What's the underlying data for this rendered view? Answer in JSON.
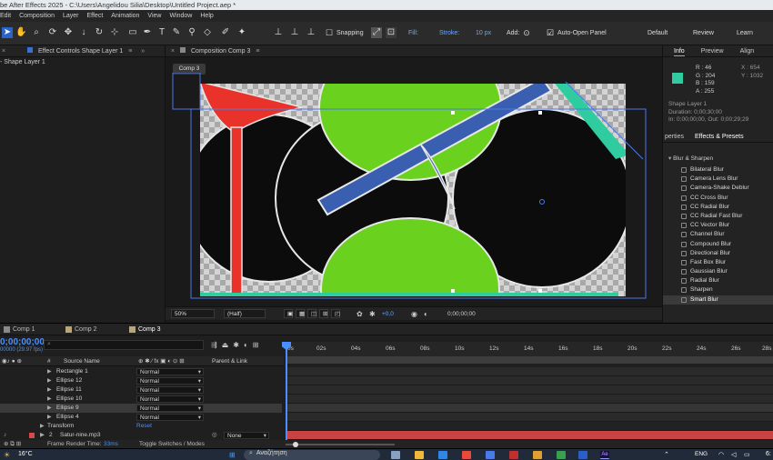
{
  "window": {
    "title": "be After Effects 2025 - C:\\Users\\Angelidou Silia\\Desktop\\Untitled Project.aep *"
  },
  "menu": [
    "Edit",
    "Composition",
    "Layer",
    "Effect",
    "Animation",
    "View",
    "Window",
    "Help"
  ],
  "toolbar": {
    "snapping": "Snapping",
    "fill": "Fill:",
    "stroke": "Stroke:",
    "stroke_px": "10 px",
    "add": "Add:",
    "auto_open": "Auto-Open Panel",
    "workspaces": [
      "Default",
      "Review",
      "Learn"
    ]
  },
  "left_panel": {
    "tab": "Effect Controls Shape Layer 1",
    "subtitle": "- Shape Layer 1"
  },
  "comp_panel": {
    "tab": "Composition Comp 3",
    "comp_button": "Comp 3"
  },
  "viewer": {
    "zoom": "50%",
    "resolution": "(Half)",
    "exposure": "+0,0",
    "timecode": "0;00;00;00"
  },
  "info_panel": {
    "tabs": [
      "Info",
      "Preview",
      "Align"
    ],
    "r": "R : 46",
    "g": "G : 204",
    "b": "B : 159",
    "a": "A : 255",
    "x": "X : 654",
    "y": "Y : 1032",
    "swatch_color": "#2ecc9f",
    "layer": "Shape Layer 1",
    "duration": "Duration: 0;00;30;00",
    "in": "In: 0;00;00;00, Out: 0;00;29;29"
  },
  "effects_panel": {
    "tabs": [
      "perties",
      "Effects & Presets"
    ],
    "category": "Blur & Sharpen",
    "items": [
      "Bilateral Blur",
      "Camera Lens Blur",
      "Camera-Shake Deblur",
      "CC Cross Blur",
      "CC Radial Blur",
      "CC Radial Fast Blur",
      "CC Vector Blur",
      "Channel Blur",
      "Compound Blur",
      "Directional Blur",
      "Fast Box Blur",
      "Gaussian Blur",
      "Radial Blur",
      "Sharpen",
      "Smart Blur"
    ],
    "selected": "Smart Blur"
  },
  "timeline": {
    "tabs": [
      {
        "label": "Comp 1",
        "color": "#8a8a8a"
      },
      {
        "label": "Comp 2",
        "color": "#b8a878"
      },
      {
        "label": "Comp 3",
        "color": "#b8a878"
      }
    ],
    "timecode": "0;00;00;00",
    "fps": "00000 (29.97 fps)",
    "col_hash": "#",
    "col_source": "Source Name",
    "col_parent": "Parent & Link",
    "layers": [
      {
        "name": "Rectangle 1",
        "mode": "Normal"
      },
      {
        "name": "Ellipse 12",
        "mode": "Normal"
      },
      {
        "name": "Ellipse 11",
        "mode": "Normal"
      },
      {
        "name": "Ellipse 10",
        "mode": "Normal"
      },
      {
        "name": "Ellipse 9",
        "mode": "Normal"
      },
      {
        "name": "Ellipse 4",
        "mode": "Normal"
      }
    ],
    "transform": "Transform",
    "reset": "Reset",
    "audio_layer": {
      "num": "2",
      "name": "Satur-nine.mp3",
      "parent": "None"
    },
    "ruler": [
      "0s",
      "02s",
      "04s",
      "06s",
      "08s",
      "10s",
      "12s",
      "14s",
      "16s",
      "18s",
      "20s",
      "22s",
      "24s",
      "26s",
      "28s"
    ],
    "frame_render_label": "Frame Render Time:",
    "frame_render_value": "33ms",
    "toggle": "Toggle Switches / Modes"
  },
  "taskbar": {
    "temp": "16°C",
    "search": "Αναζήτηση",
    "lang": "ENG",
    "clock": "6:"
  },
  "colors": {
    "green": "#6ad11e",
    "blue": "#3a5fb0",
    "red": "#e8322a",
    "teal": "#2ecc9f",
    "accent": "#2a64c8"
  }
}
